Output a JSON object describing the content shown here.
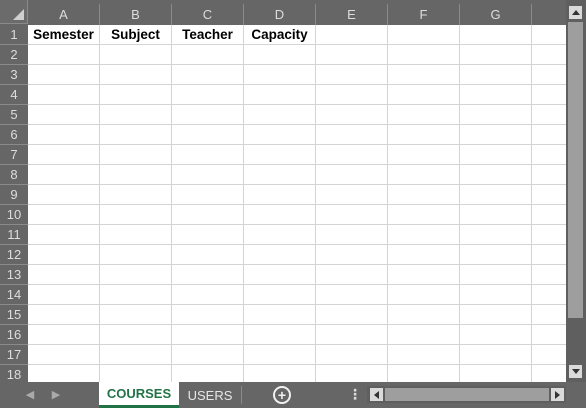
{
  "columns": [
    "A",
    "B",
    "C",
    "D",
    "E",
    "F",
    "G"
  ],
  "rows": [
    "1",
    "2",
    "3",
    "4",
    "5",
    "6",
    "7",
    "8",
    "9",
    "10",
    "11",
    "12",
    "13",
    "14",
    "15",
    "16",
    "17",
    "18"
  ],
  "cells": {
    "A1": "Semester",
    "B1": "Subject",
    "C1": "Teacher",
    "D1": "Capacity"
  },
  "sheet_tabs": [
    {
      "label": "COURSES",
      "active": true
    },
    {
      "label": "USERS",
      "active": false
    }
  ],
  "icons": {
    "select_all": "select-all-triangle",
    "add_sheet": "plus-circle-icon",
    "more": "vertical-dots-icon",
    "tab_prev": "triangle-left-icon",
    "tab_next": "triangle-right-icon"
  },
  "colors": {
    "active_tab_text": "#217346",
    "header_background": "#666666",
    "grid_background": "#ffffff",
    "gridline": "#d4d4d4"
  }
}
